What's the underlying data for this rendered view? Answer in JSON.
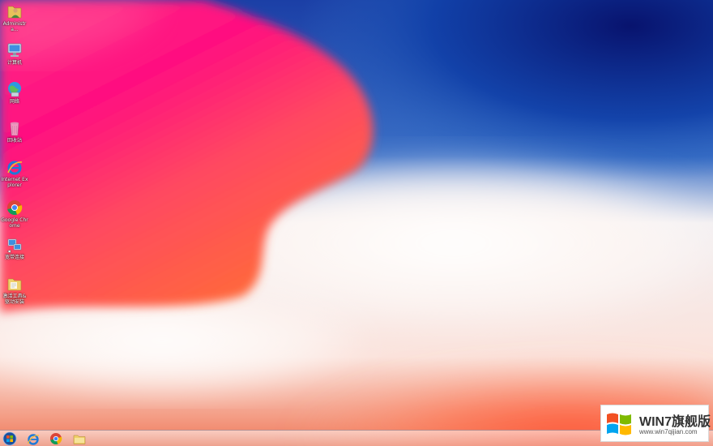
{
  "desktop": {
    "icons": [
      {
        "label": "Administra...",
        "icon": "user-folder-icon"
      },
      {
        "label": "计算机",
        "icon": "computer-icon"
      },
      {
        "label": "网络",
        "icon": "network-icon"
      },
      {
        "label": "回收站",
        "icon": "recycle-bin-icon"
      },
      {
        "label": "Internet Explorer",
        "icon": "internet-explorer-icon"
      },
      {
        "label": "Google Chrome",
        "icon": "chrome-icon"
      },
      {
        "label": "宽带连接",
        "icon": "broadband-connection-icon"
      },
      {
        "label": "激活工具&驱动安装",
        "icon": "folder-icon"
      }
    ]
  },
  "taskbar": {
    "items": [
      {
        "icon": "start-orb-icon"
      },
      {
        "icon": "internet-explorer-icon"
      },
      {
        "icon": "chrome-icon"
      },
      {
        "icon": "file-explorer-icon"
      }
    ]
  },
  "watermark": {
    "title": "WIN7旗舰版",
    "url": "www.win7qijian.com"
  }
}
